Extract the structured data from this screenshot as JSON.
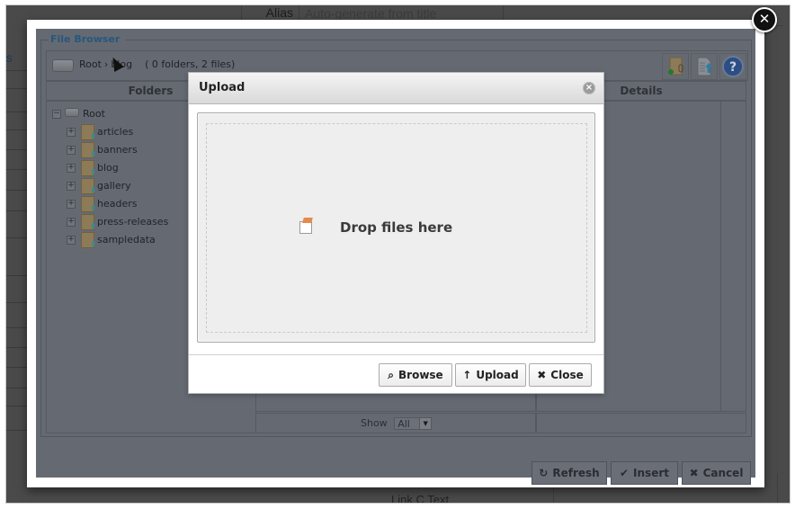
{
  "background_page": {
    "alias_label": "Alias",
    "alias_placeholder": "Auto-generate from title",
    "side_text_fragment": "ns",
    "bottom_text": "Link C Text"
  },
  "modal": {
    "close_icon": "close-circle-icon"
  },
  "file_browser": {
    "legend": "File Browser",
    "breadcrumb": {
      "root": "Root",
      "separator": "›",
      "current": "blog"
    },
    "counts": "( 0 folders, 2 files)",
    "toolbar_icons": [
      "new-folder-icon",
      "upload-file-icon",
      "help-icon"
    ],
    "columns": {
      "folders": "Folders",
      "files": "",
      "details": "Details"
    },
    "tree": {
      "root": "Root",
      "folders": [
        "articles",
        "banners",
        "blog",
        "gallery",
        "headers",
        "press-releases",
        "sampledata"
      ]
    },
    "show_label": "Show",
    "show_value": "All",
    "buttons": {
      "refresh": "Refresh",
      "insert": "Insert",
      "cancel": "Cancel"
    }
  },
  "upload_dialog": {
    "title": "Upload",
    "drop_text": "Drop files here",
    "buttons": {
      "browse": "Browse",
      "upload": "Upload",
      "close": "Close"
    }
  }
}
